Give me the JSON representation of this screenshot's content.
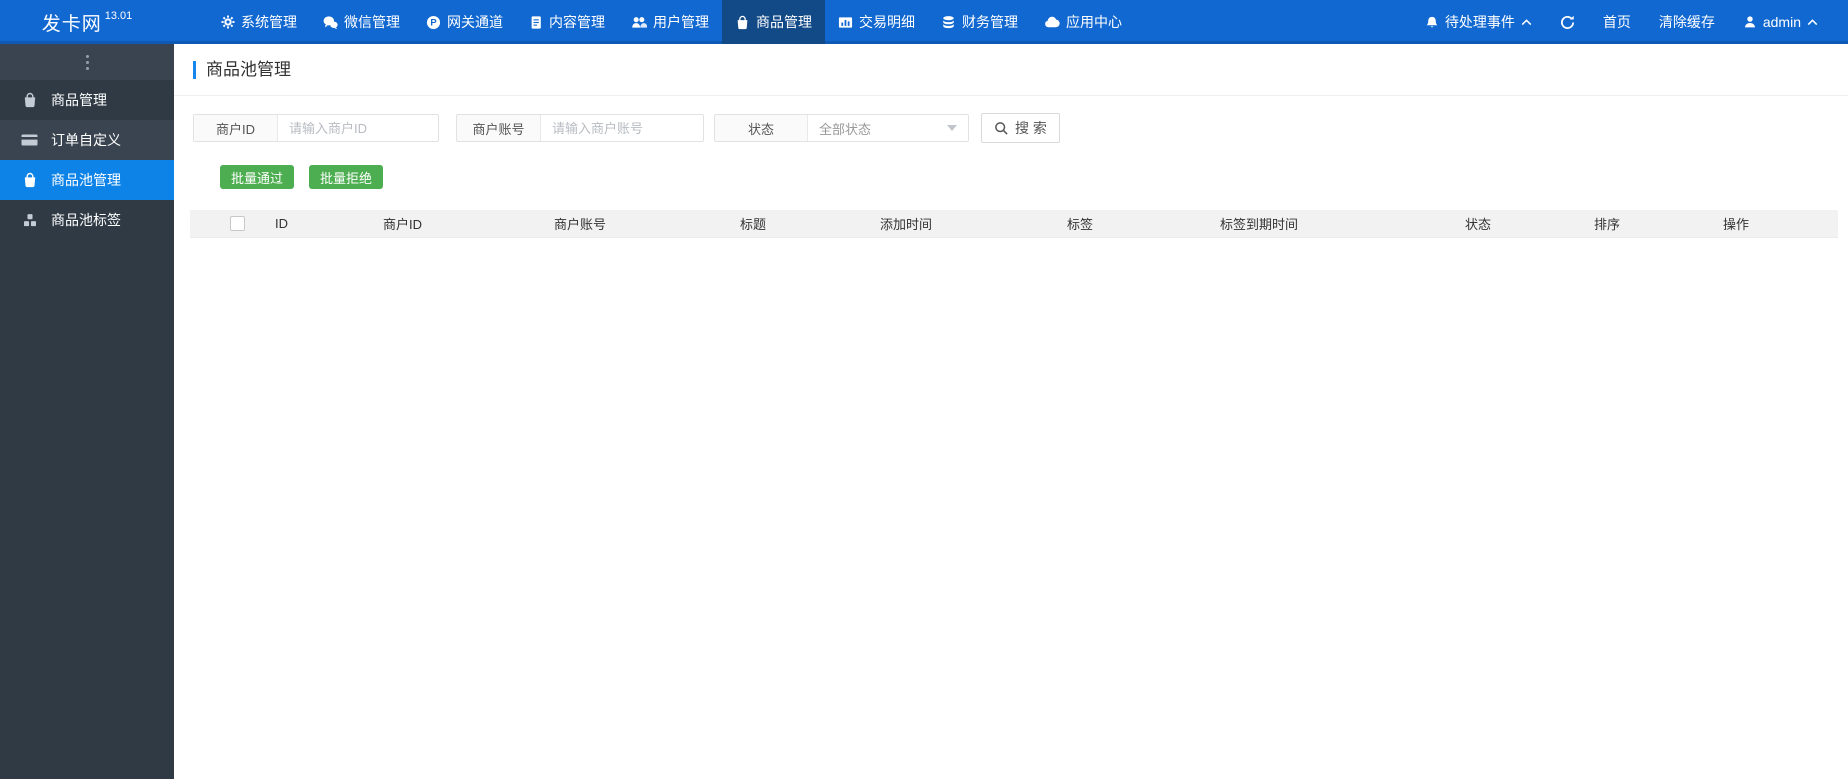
{
  "brand": {
    "name": "发卡网",
    "version": "13.01"
  },
  "navbar": {
    "items": [
      {
        "label": "系统管理",
        "icon": "gear-icon",
        "active": false
      },
      {
        "label": "微信管理",
        "icon": "wechat-icon",
        "active": false
      },
      {
        "label": "网关通道",
        "icon": "gateway-icon",
        "active": false
      },
      {
        "label": "内容管理",
        "icon": "document-icon",
        "active": false
      },
      {
        "label": "用户管理",
        "icon": "users-icon",
        "active": false
      },
      {
        "label": "商品管理",
        "icon": "shopping-bag-icon",
        "active": true
      },
      {
        "label": "交易明细",
        "icon": "bar-chart-icon",
        "active": false
      },
      {
        "label": "财务管理",
        "icon": "finance-icon",
        "active": false
      },
      {
        "label": "应用中心",
        "icon": "cloud-icon",
        "active": false
      }
    ],
    "right": {
      "pending_events": "待处理事件",
      "home": "首页",
      "clear_cache": "清除缓存",
      "username": "admin"
    }
  },
  "sidebar": {
    "items": [
      {
        "label": "商品管理",
        "icon": "shopping-bag-icon",
        "active": false
      },
      {
        "label": "订单自定义",
        "icon": "credit-card-icon",
        "active": false
      },
      {
        "label": "商品池管理",
        "icon": "shopping-bag-icon",
        "active": true
      },
      {
        "label": "商品池标签",
        "icon": "cubes-icon",
        "active": false
      }
    ]
  },
  "page": {
    "title": "商品池管理"
  },
  "filters": {
    "merchant_id": {
      "label": "商户ID",
      "placeholder": "请输入商户ID",
      "value": ""
    },
    "merchant_account": {
      "label": "商户账号",
      "placeholder": "请输入商户账号",
      "value": ""
    },
    "status": {
      "label": "状态",
      "value": "全部状态"
    },
    "search_label": "搜 索"
  },
  "actions": {
    "batch_approve": "批量通过",
    "batch_reject": "批量拒绝"
  },
  "table": {
    "columns": [
      "ID",
      "商户ID",
      "商户账号",
      "标题",
      "添加时间",
      "标签",
      "标签到期时间",
      "状态",
      "排序",
      "操作"
    ],
    "rows": []
  },
  "colors": {
    "navbar": "#1168d1",
    "navbar_active": "#124a87",
    "sidebar": "#2f3a45",
    "sidebar_active": "#0d83e8",
    "accent": "#1586ec",
    "success_green": "#4cae50"
  }
}
